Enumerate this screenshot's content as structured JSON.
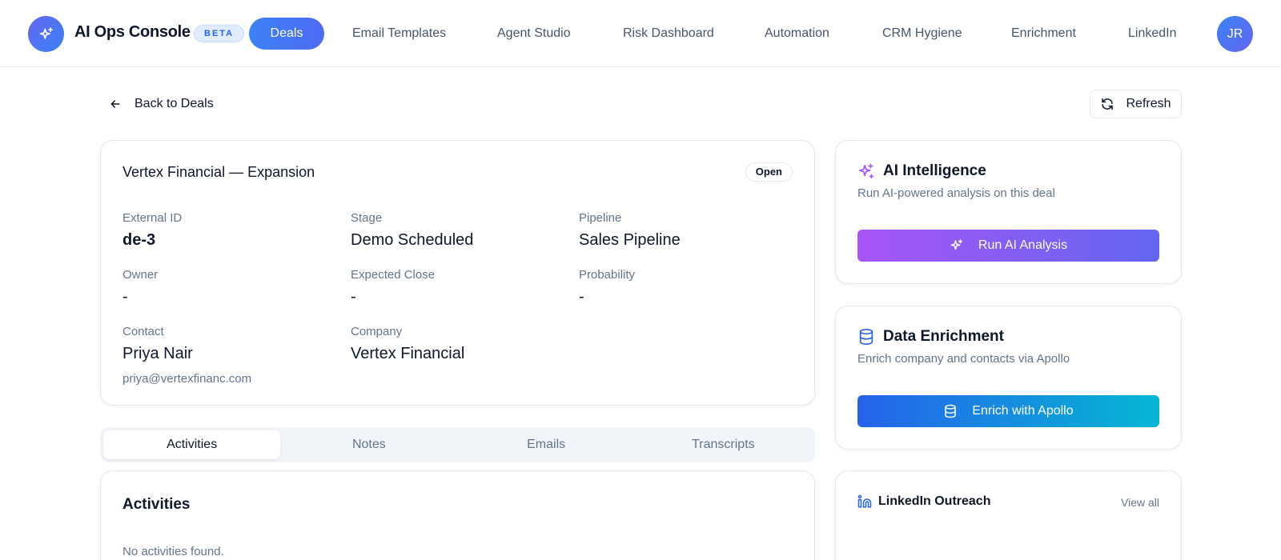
{
  "app": {
    "title": "AI Ops Console",
    "badge": "BETA",
    "user_initials": "JR"
  },
  "nav": {
    "items": [
      {
        "label": "Deals",
        "active": true
      },
      {
        "label": "Email Templates"
      },
      {
        "label": "Agent Studio"
      },
      {
        "label": "Risk Dashboard"
      },
      {
        "label": "Automation"
      },
      {
        "label": "CRM Hygiene"
      },
      {
        "label": "Enrichment"
      },
      {
        "label": "LinkedIn"
      }
    ]
  },
  "toolbar": {
    "back_label": "Back to Deals",
    "refresh_label": "Refresh"
  },
  "deal": {
    "title": "Vertex Financial — Expansion",
    "status": "Open",
    "fields": {
      "external_id": {
        "label": "External ID",
        "value": "de-3"
      },
      "stage": {
        "label": "Stage",
        "value": "Demo Scheduled"
      },
      "pipeline": {
        "label": "Pipeline",
        "value": "Sales Pipeline"
      },
      "owner": {
        "label": "Owner",
        "value": "-"
      },
      "expected_close": {
        "label": "Expected Close",
        "value": "-"
      },
      "probability": {
        "label": "Probability",
        "value": "-"
      },
      "contact": {
        "label": "Contact",
        "value": "Priya Nair",
        "email": "priya@vertexfinanc.com"
      },
      "company": {
        "label": "Company",
        "value": "Vertex Financial"
      }
    }
  },
  "tabs": [
    {
      "label": "Activities",
      "active": true
    },
    {
      "label": "Notes"
    },
    {
      "label": "Emails"
    },
    {
      "label": "Transcripts"
    }
  ],
  "activities": {
    "title": "Activities",
    "empty": "No activities found."
  },
  "ai_card": {
    "title": "AI Intelligence",
    "subtitle": "Run AI-powered analysis on this deal",
    "button": "Run AI Analysis"
  },
  "enrich_card": {
    "title": "Data Enrichment",
    "subtitle": "Enrich company and contacts via Apollo",
    "button": "Enrich with Apollo"
  },
  "linkedin_card": {
    "title": "LinkedIn Outreach",
    "view_all": "View all"
  },
  "colors": {
    "accent": "#3b82f6",
    "ai_gradient": [
      "#a855f7",
      "#6366f1"
    ],
    "enrich_gradient": [
      "#2563eb",
      "#06b6d4"
    ]
  }
}
